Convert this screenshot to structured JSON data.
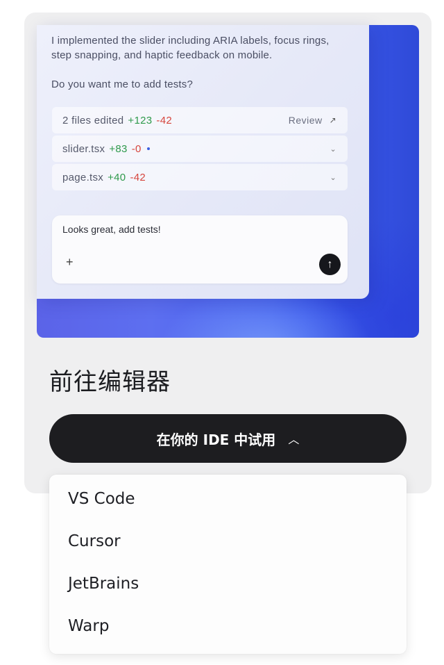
{
  "chat": {
    "message_line1": "I implemented the slider including ARIA labels, focus rings, step snapping, and haptic feedback on mobile.",
    "message_question": "Do you want me to add tests?",
    "summary": {
      "label": "2 files edited",
      "added": "+123",
      "removed": "-42",
      "review_label": "Review",
      "review_icon": "arrow-up-right-icon"
    },
    "files": [
      {
        "name": "slider.tsx",
        "added": "+83",
        "removed": "-0",
        "modified_dot": true
      },
      {
        "name": "page.tsx",
        "added": "+40",
        "removed": "-42",
        "modified_dot": false
      }
    ],
    "input": {
      "value": "Looks great, add tests!",
      "plus": "+",
      "send_icon": "arrow-up-icon"
    }
  },
  "section_title": "前往编辑器",
  "cta": {
    "label": "在你的 IDE 中试用",
    "caret": "^"
  },
  "dropdown": {
    "items": [
      "VS Code",
      "Cursor",
      "JetBrains",
      "Warp"
    ]
  },
  "colors": {
    "added": "#2f9a4c",
    "removed": "#d6453d",
    "cta_bg": "#1d1d20",
    "hero_blue": "#3f5ef0"
  }
}
